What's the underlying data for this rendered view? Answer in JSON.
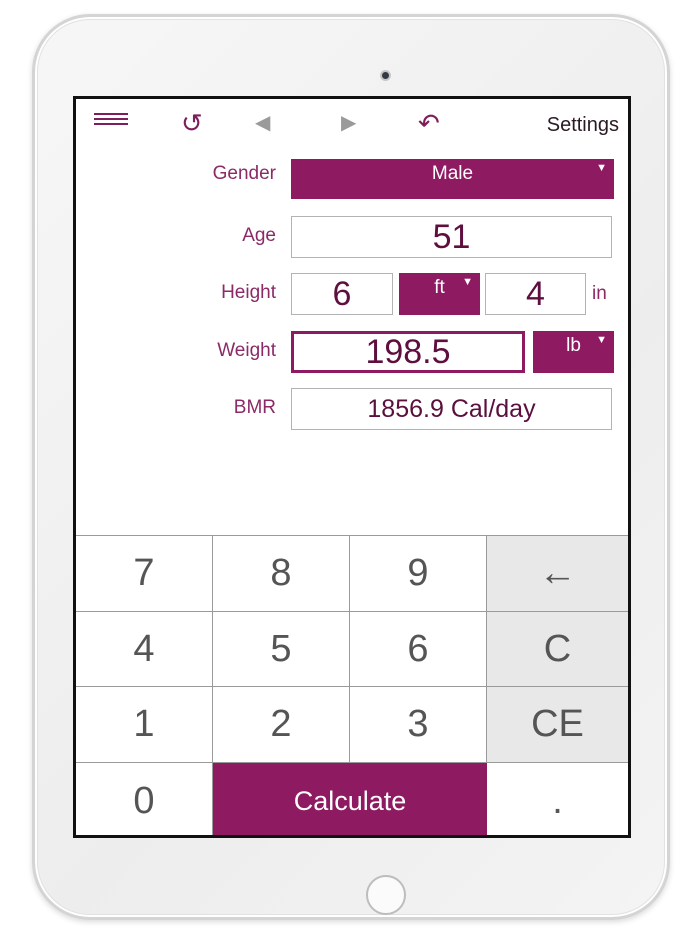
{
  "toolbar": {
    "menu_icon": "hamburger-menu-icon",
    "refresh_icon": "refresh-icon",
    "prev_icon": "chevron-left-icon",
    "next_icon": "chevron-right-icon",
    "undo_icon": "undo-icon",
    "settings_label": "Settings"
  },
  "form": {
    "gender": {
      "label": "Gender",
      "value": "Male"
    },
    "age": {
      "label": "Age",
      "value": "51"
    },
    "height": {
      "label": "Height",
      "feet": "6",
      "feet_unit": "ft",
      "inches": "4",
      "inches_unit": "in"
    },
    "weight": {
      "label": "Weight",
      "value": "198.5",
      "unit": "lb"
    },
    "bmr": {
      "label": "BMR",
      "value": "1856.9 Cal/day"
    }
  },
  "keypad": {
    "k7": "7",
    "k8": "8",
    "k9": "9",
    "backspace": "←",
    "k4": "4",
    "k5": "5",
    "k6": "6",
    "clear": "C",
    "k1": "1",
    "k2": "2",
    "k3": "3",
    "clear_entry": "CE",
    "k0": "0",
    "calculate": "Calculate",
    "decimal": "."
  },
  "colors": {
    "accent": "#8e1a62",
    "label_text": "#8b2a66",
    "function_key_bg": "#e8e8e8"
  }
}
